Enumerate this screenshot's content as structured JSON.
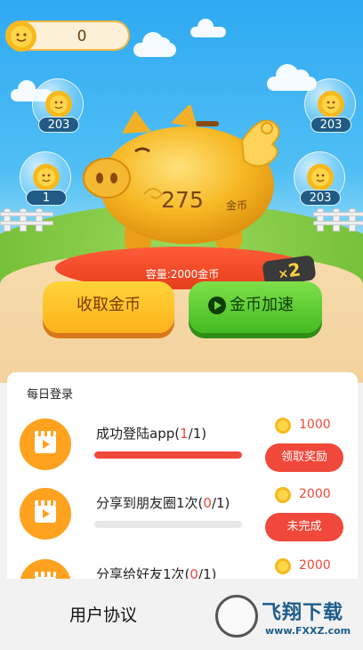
{
  "header": {
    "balance": "0"
  },
  "bubbles": [
    {
      "count": "203"
    },
    {
      "count": "203"
    },
    {
      "count": "1"
    },
    {
      "count": "203"
    }
  ],
  "pig": {
    "coins": "275",
    "unit": "金币",
    "capacity": "容量:2000金币",
    "multiplier": "2",
    "multiplier_prefix": "×"
  },
  "actions": {
    "collect": "收取金币",
    "boost": "金币加速"
  },
  "daily": {
    "title": "每日登录",
    "tasks": [
      {
        "name": "成功登陆app(",
        "done": "1",
        "total": "/1)",
        "progress": 1.0,
        "reward": "1000",
        "button": "领取奖励"
      },
      {
        "name": "分享到朋友圈1次(",
        "done": "0",
        "total": "/1)",
        "progress": 0.0,
        "reward": "2000",
        "button": "未完成"
      },
      {
        "name": "分享给好友1次(",
        "done": "0",
        "total": "/1)",
        "progress": 0.0,
        "reward": "2000",
        "button": ""
      }
    ]
  },
  "footer": {
    "agreement": "用户协议"
  },
  "watermark": {
    "text": "飞翔下载",
    "url": "www.FXXZ.com"
  },
  "colors": {
    "accent_red": "#f0483a",
    "gold": "#f7b91c",
    "green": "#44bb22",
    "sky": "#2ea9f2"
  }
}
